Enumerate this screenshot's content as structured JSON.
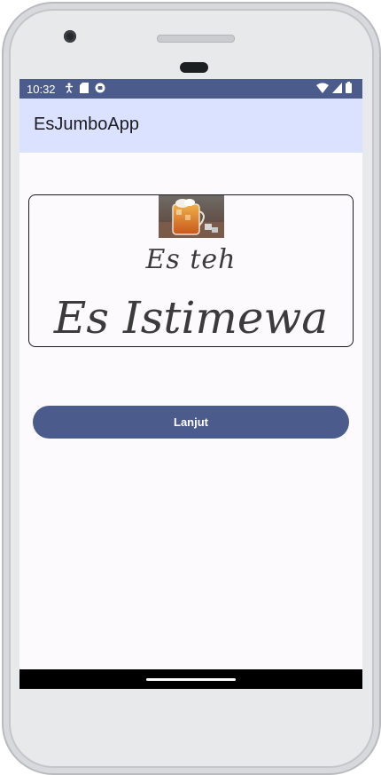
{
  "status_bar": {
    "time": "10:32",
    "left_icons": [
      "accessibility-icon",
      "sd-card-icon",
      "app-notification-icon"
    ],
    "right_icons": [
      "wifi-icon",
      "cell-signal-icon",
      "battery-icon"
    ]
  },
  "app_bar": {
    "title": "EsJumboApp"
  },
  "card": {
    "image_icon": "iced-tea-photo",
    "subtitle": "Es teh",
    "title": "Es Istimewa"
  },
  "action": {
    "button_label": "Lanjut"
  },
  "colors": {
    "primary": "#4a5b8c",
    "app_bar": "#dbe2ff",
    "background": "#fcfafd",
    "nav_bar": "#000000"
  }
}
